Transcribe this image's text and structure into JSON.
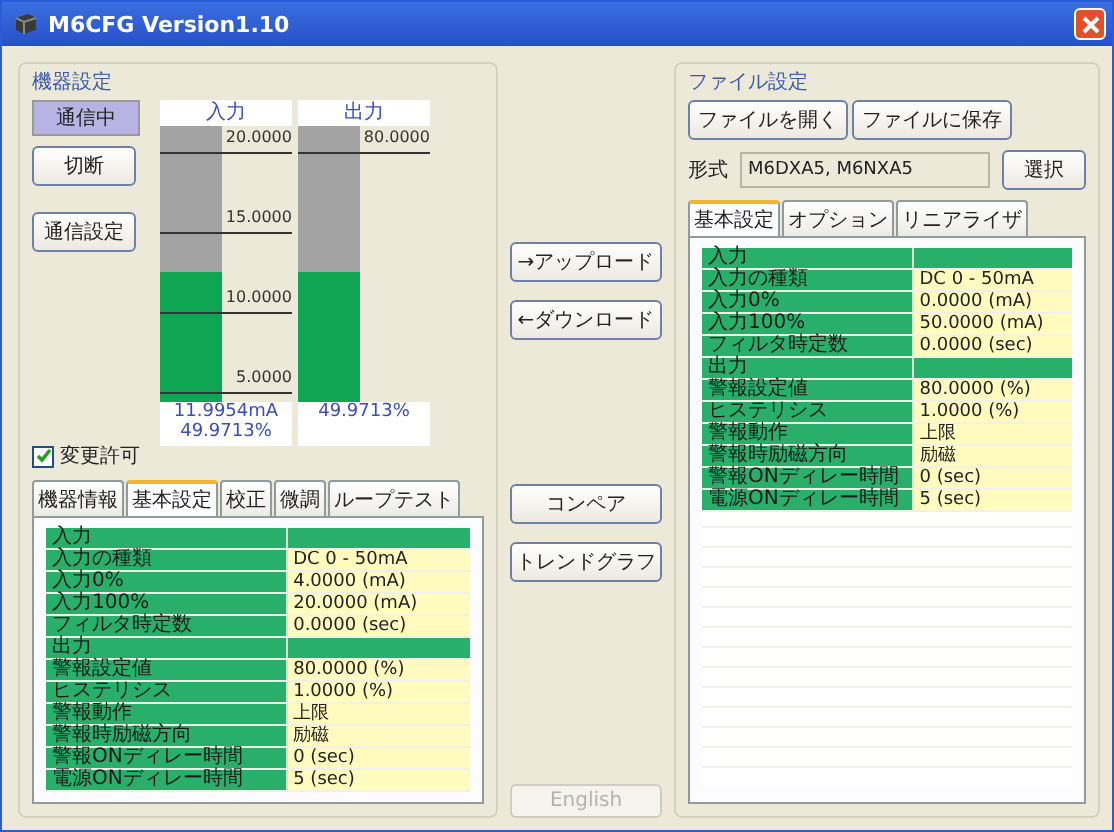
{
  "window": {
    "title": "M6CFG Version1.10"
  },
  "device_settings": {
    "title": "機器設定",
    "status": "通信中",
    "buttons": [
      "切断",
      "通信設定"
    ],
    "meters": [
      {
        "header": "入力",
        "level": 0.47,
        "ticks": [
          "20.0000",
          "15.0000",
          "10.0000",
          "5.0000"
        ],
        "readings": [
          "11.9954mA",
          "49.9713%"
        ]
      },
      {
        "header": "出力",
        "level": 0.47,
        "ticks": [
          "80.0000"
        ],
        "readings": [
          "49.9713%"
        ]
      }
    ],
    "allow_change": {
      "label": "変更許可",
      "checked": true
    },
    "tabs": [
      {
        "label": "機器情報",
        "selected": false
      },
      {
        "label": "基本設定",
        "selected": true
      },
      {
        "label": "校正",
        "selected": false
      },
      {
        "label": "微調",
        "selected": false
      },
      {
        "label": "ループテスト",
        "selected": false
      }
    ],
    "table": {
      "rows": [
        {
          "kind": "section",
          "label": "入力"
        },
        {
          "kind": "param",
          "label": "入力の種類",
          "value": "DC 0 - 50mA"
        },
        {
          "kind": "param",
          "label": "入力0%",
          "value": "4.0000 (mA)"
        },
        {
          "kind": "param",
          "label": "入力100%",
          "value": "20.0000 (mA)"
        },
        {
          "kind": "param",
          "label": "フィルタ時定数",
          "value": "0.0000 (sec)"
        },
        {
          "kind": "section",
          "label": "出力"
        },
        {
          "kind": "param",
          "label": "警報設定値",
          "value": "80.0000 (%)"
        },
        {
          "kind": "param",
          "label": "ヒステリシス",
          "value": "1.0000 (%)"
        },
        {
          "kind": "param",
          "label": "警報動作",
          "value": "上限"
        },
        {
          "kind": "param",
          "label": "警報時励磁方向",
          "value": "励磁"
        },
        {
          "kind": "param",
          "label": "警報ONディレー時間",
          "value": "0 (sec)"
        },
        {
          "kind": "param",
          "label": "電源ONディレー時間",
          "value": "5 (sec)"
        }
      ]
    }
  },
  "transfer_buttons": [
    {
      "label": "→アップロード",
      "disabled": false
    },
    {
      "label": "←ダウンロード",
      "disabled": false
    }
  ],
  "tool_buttons": [
    {
      "label": "コンペア",
      "disabled": false
    },
    {
      "label": "トレンドグラフ",
      "disabled": false
    }
  ],
  "language_button": {
    "label": "English",
    "disabled": true
  },
  "file_settings": {
    "title": "ファイル設定",
    "buttons": [
      "ファイルを開く",
      "ファイルに保存"
    ],
    "model_label": "形式",
    "model_value": "M6DXA5, M6NXA5",
    "select_button": "選択",
    "tabs": [
      {
        "label": "基本設定",
        "selected": true
      },
      {
        "label": "オプション",
        "selected": false
      },
      {
        "label": "リニアライザ",
        "selected": false
      }
    ],
    "table": {
      "rows": [
        {
          "kind": "section",
          "label": "入力"
        },
        {
          "kind": "param",
          "label": "入力の種類",
          "value": "DC 0 - 50mA"
        },
        {
          "kind": "param",
          "label": "入力0%",
          "value": "0.0000 (mA)"
        },
        {
          "kind": "param",
          "label": "入力100%",
          "value": "50.0000 (mA)"
        },
        {
          "kind": "param",
          "label": "フィルタ時定数",
          "value": "0.0000 (sec)"
        },
        {
          "kind": "section",
          "label": "出力"
        },
        {
          "kind": "param",
          "label": "警報設定値",
          "value": "80.0000 (%)"
        },
        {
          "kind": "param",
          "label": "ヒステリシス",
          "value": "1.0000 (%)"
        },
        {
          "kind": "param",
          "label": "警報動作",
          "value": "上限"
        },
        {
          "kind": "param",
          "label": "警報時励磁方向",
          "value": "励磁"
        },
        {
          "kind": "param",
          "label": "警報ONディレー時間",
          "value": "0 (sec)"
        },
        {
          "kind": "param",
          "label": "電源ONディレー時間",
          "value": "5 (sec)"
        }
      ]
    }
  }
}
